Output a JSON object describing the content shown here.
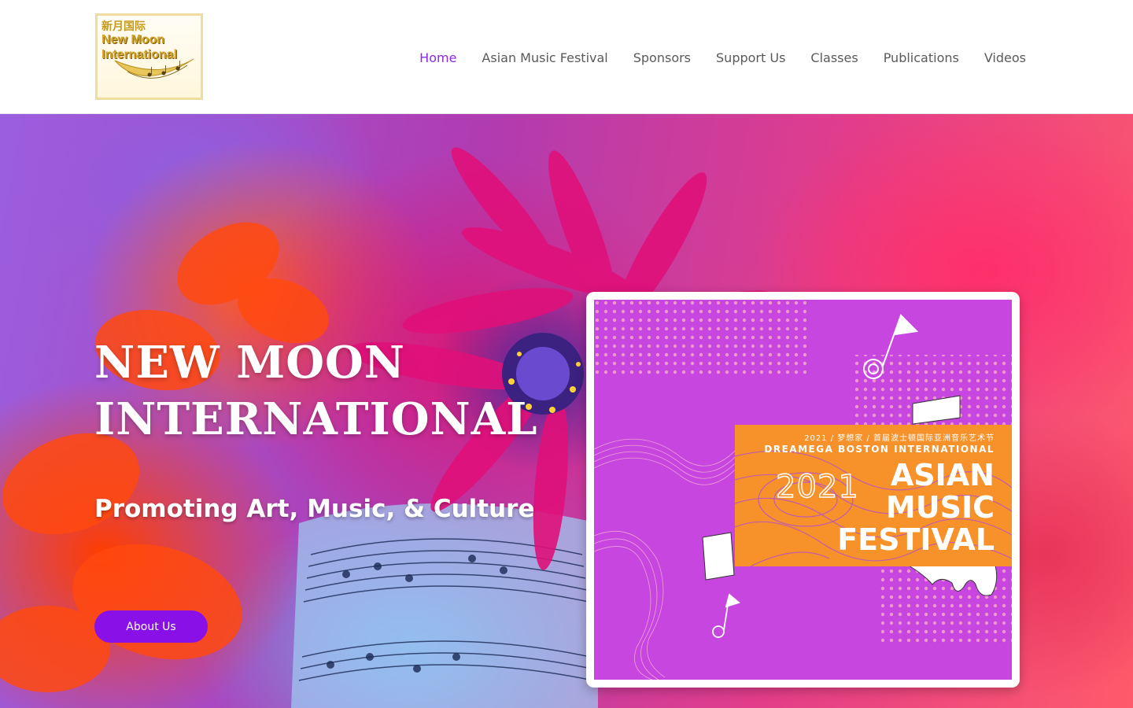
{
  "header": {
    "logo": {
      "alt": "New Moon International logo",
      "text_cn": "新月国际",
      "text_en_line1": "New Moon",
      "text_en_line2": "International"
    },
    "nav": [
      {
        "label": "Home",
        "active": true
      },
      {
        "label": "Asian Music Festival",
        "active": false
      },
      {
        "label": "Sponsors",
        "active": false
      },
      {
        "label": "Support Us",
        "active": false
      },
      {
        "label": "Classes",
        "active": false
      },
      {
        "label": "Publications",
        "active": false
      },
      {
        "label": "Videos",
        "active": false
      }
    ]
  },
  "hero": {
    "title_line1": "NEW MOON",
    "title_line2": "INTERNATIONAL",
    "subtitle": "Promoting Art, Music, & Culture",
    "button_label": "About Us"
  },
  "festival_card": {
    "banner_cn": "2021 / 梦想家 / 首届波士顿国际亚洲音乐艺术节",
    "banner_en": "DREAMEGA BOSTON INTERNATIONAL",
    "year": "2021",
    "title_line1": "ASIAN",
    "title_line2": "MUSIC",
    "title_line3": "FESTIVAL"
  },
  "colors": {
    "accent": "#8a10e8",
    "nav_active": "#8a2be2",
    "nav_text": "#5a5a5a",
    "poster_purple": "#c846e0",
    "banner_orange": "#f7922a",
    "logo_gold": "#d5a527"
  }
}
